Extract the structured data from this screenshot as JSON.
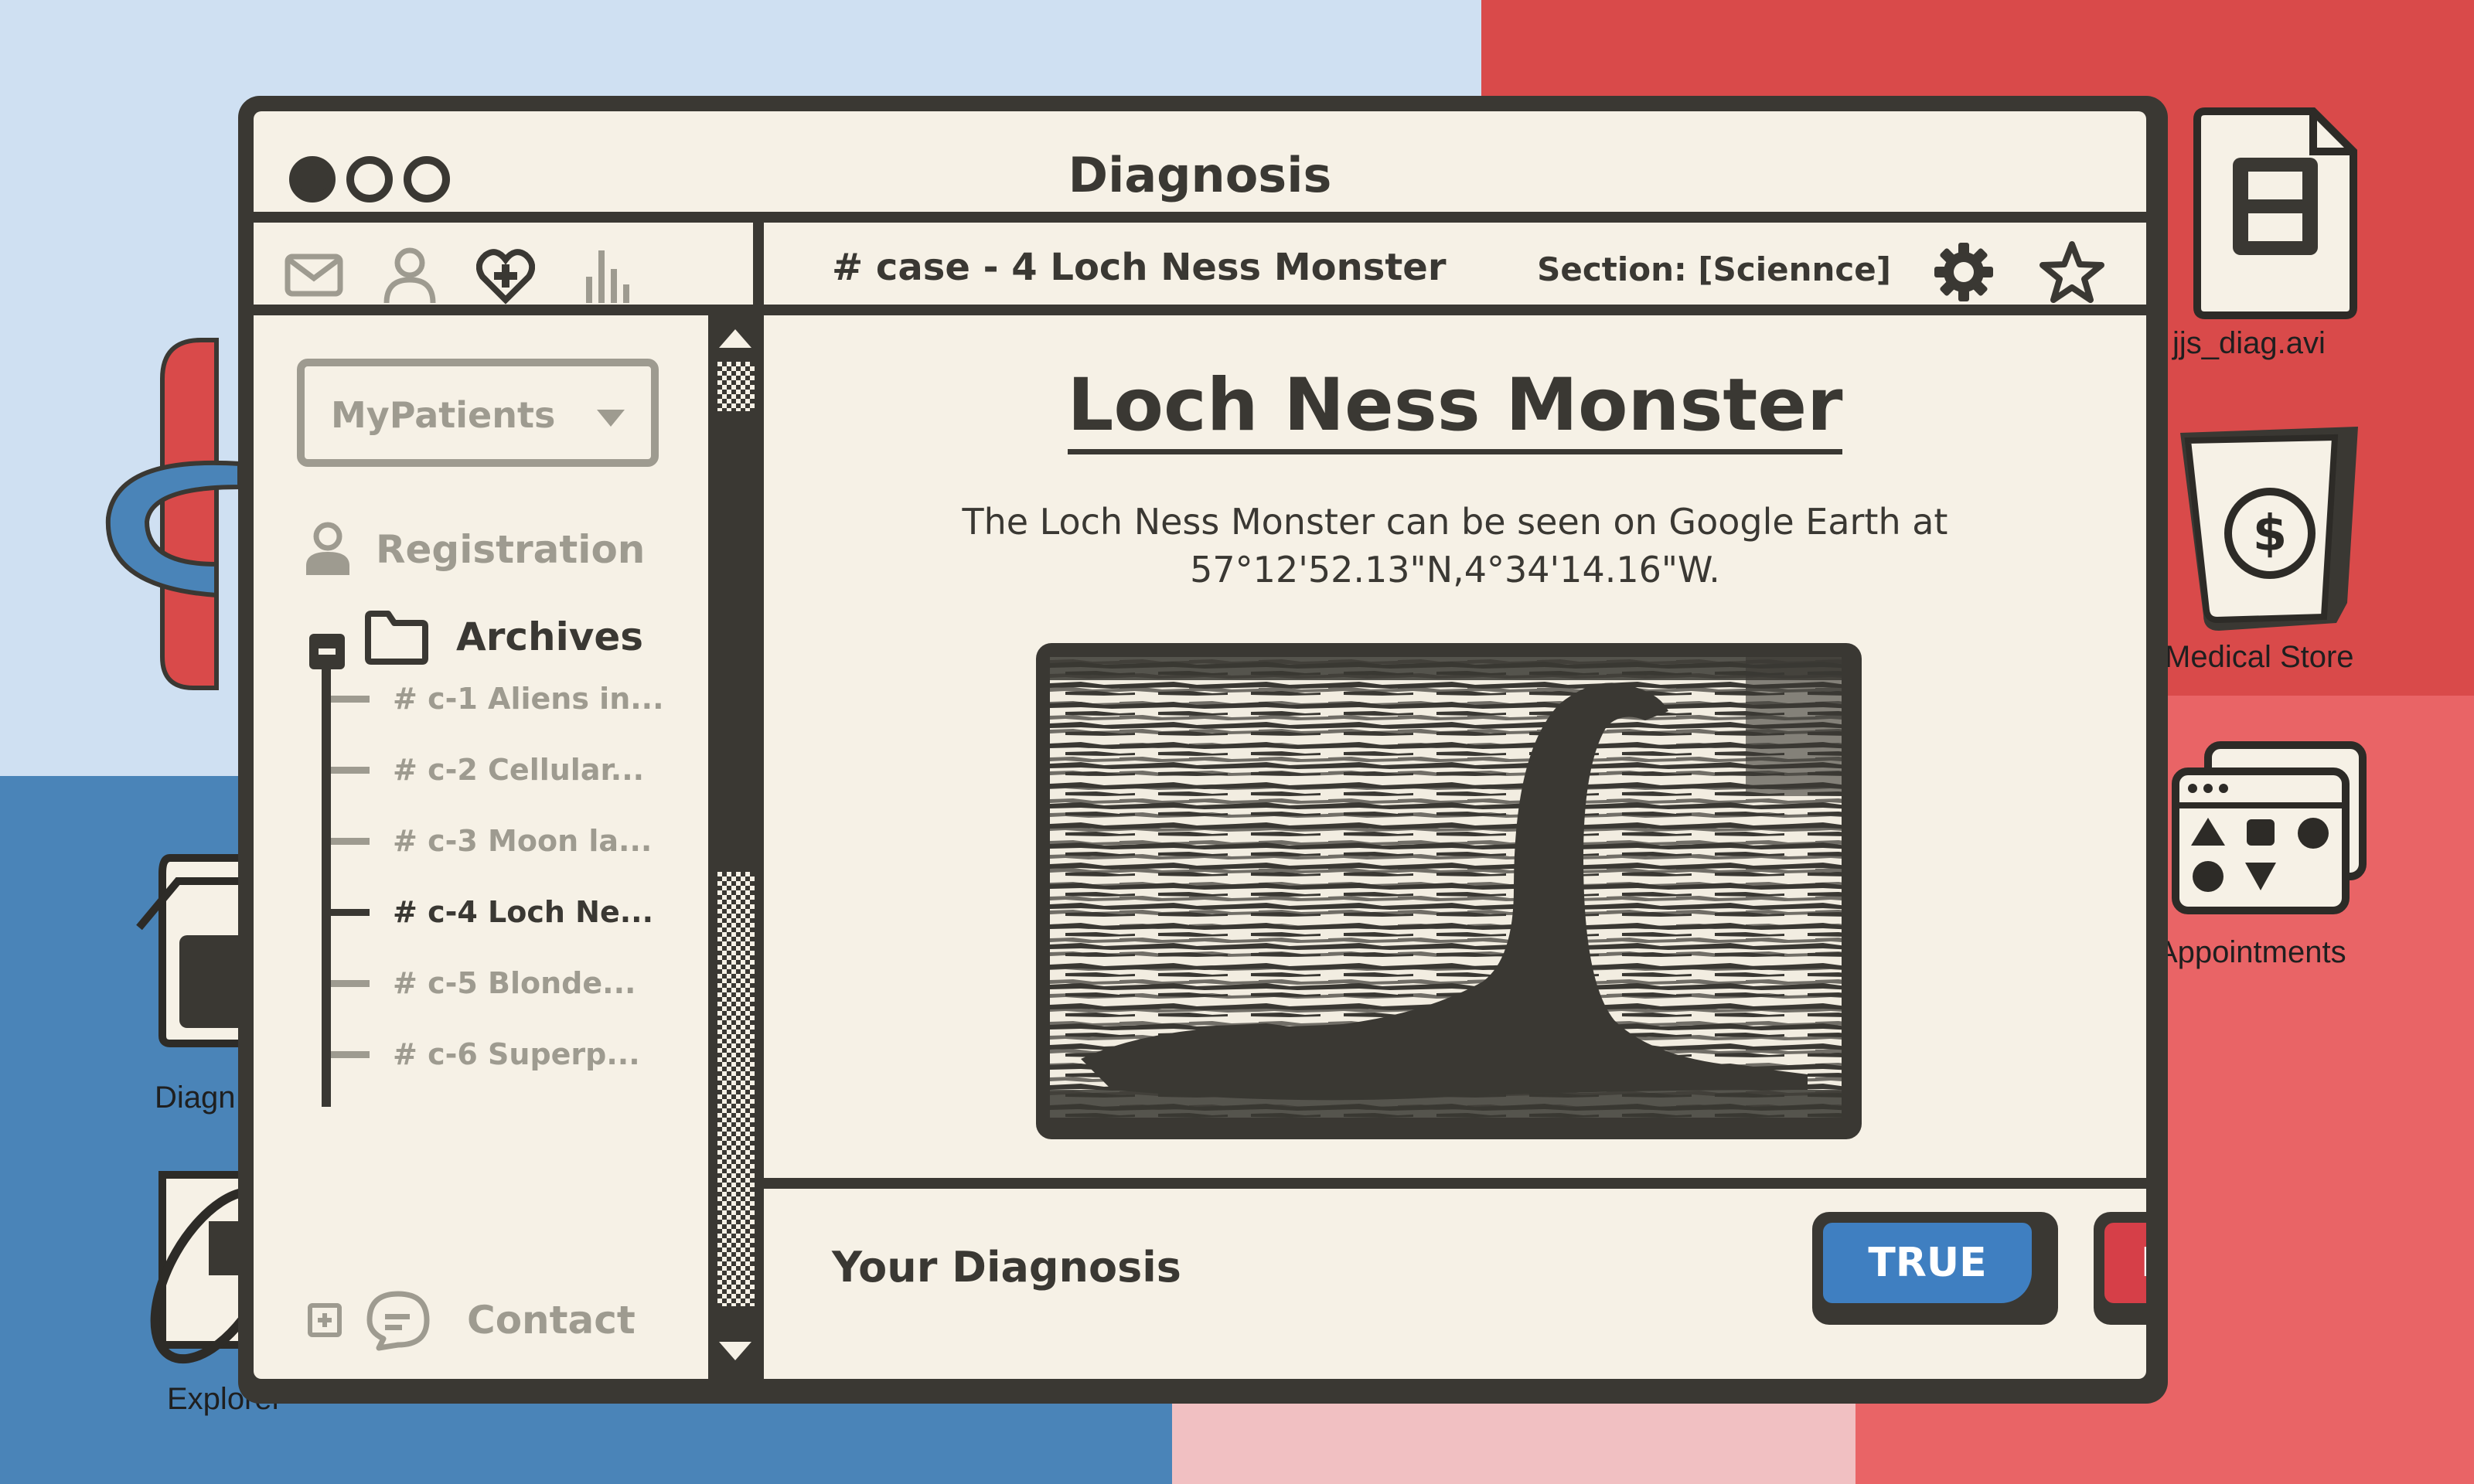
{
  "window": {
    "title": "Diagnosis",
    "controls": [
      "close-dot",
      "minimize-dot",
      "maximize-dot"
    ]
  },
  "toolbar": {
    "icons": [
      "mail-icon",
      "user-icon",
      "heart-plus-icon",
      "bar-chart-icon"
    ],
    "case_title": "# case - 4 Loch Ness Monster",
    "section_label": "Section: [Sciennce]",
    "settings_icon": "gear-icon",
    "favorite_icon": "star-icon"
  },
  "sidebar": {
    "dropdown_value": "MyPatients",
    "registration_label": "Registration",
    "archives_label": "Archives",
    "cases": [
      {
        "label": "# c-1 Aliens in..."
      },
      {
        "label": "# c-2 Cellular..."
      },
      {
        "label": "# c-3 Moon la..."
      },
      {
        "label": "# c-4 Loch Ne..."
      },
      {
        "label": "# c-5 Blonde..."
      },
      {
        "label": "# c-6 Superp..."
      }
    ],
    "active_case_index": 3,
    "contact_label": "Contact"
  },
  "content": {
    "heading": "Loch Ness Monster",
    "description_line1": "The Loch Ness Monster can be seen on Google Earth at",
    "description_line2": "57°12'52.13\"N,4°34'14.16\"W.",
    "image_subject": "Loch Ness Monster photograph"
  },
  "diagnosis": {
    "label": "Your Diagnosis",
    "true_label": "TRUE",
    "false_label": "FALSE"
  },
  "desktop": {
    "icons": [
      {
        "label": "jjs_diag.avi",
        "icon": "video-file-icon"
      },
      {
        "label": "Medical Store",
        "icon": "store-bag-icon"
      },
      {
        "label": "Appointments",
        "icon": "apps-folder-icon"
      },
      {
        "label": "Diagn",
        "icon": "diagnosis-jar-icon"
      },
      {
        "label": "Explorer",
        "icon": "explorer-icon"
      }
    ]
  },
  "colors": {
    "dark": "#3a3833",
    "paper": "#f6f1e6",
    "muted": "#9e9b90",
    "true_blue": "#3f7fc1",
    "false_red": "#d63f48",
    "bg_light_blue": "#cfe0f2",
    "bg_red": "#d94a4a",
    "bg_blue": "#4a84b8",
    "bg_pink": "#f1c0c2",
    "bg_coral": "#e96466"
  }
}
